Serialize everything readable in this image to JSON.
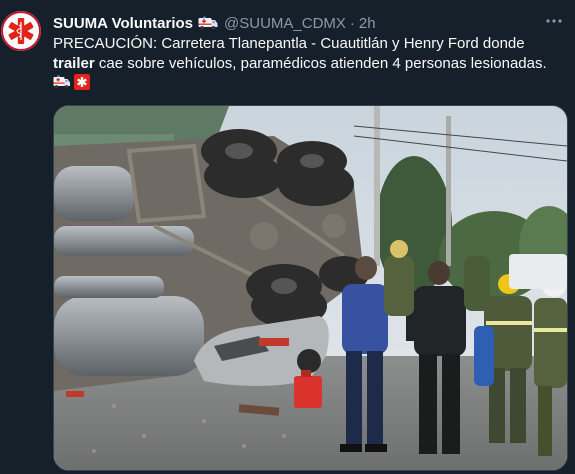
{
  "tweet": {
    "display_name": "SUUMA Voluntarios",
    "handle": "@SUUMA_CDMX",
    "separator": "·",
    "time": "2h",
    "more_icon": "more-horizontal-icon",
    "text_part1": "PRECAUCIÓN: Carretera Tlanepantla - Cuautitlán y Henry Ford donde",
    "text_bold": "trailer",
    "text_part2": " cae sobre vehículos, paramédicos atienden 4 personas lesionadas.",
    "emojis": [
      "ambulance-emoji",
      "red-cross-emoji"
    ],
    "avatar_icon": "star-of-life-icon",
    "media_alt": "trailer overturned on vehicles, paramedics on scene"
  },
  "colors": {
    "background": "#15202b",
    "text": "#f7f9f9",
    "muted": "#8b98a5",
    "border": "#38444d"
  }
}
